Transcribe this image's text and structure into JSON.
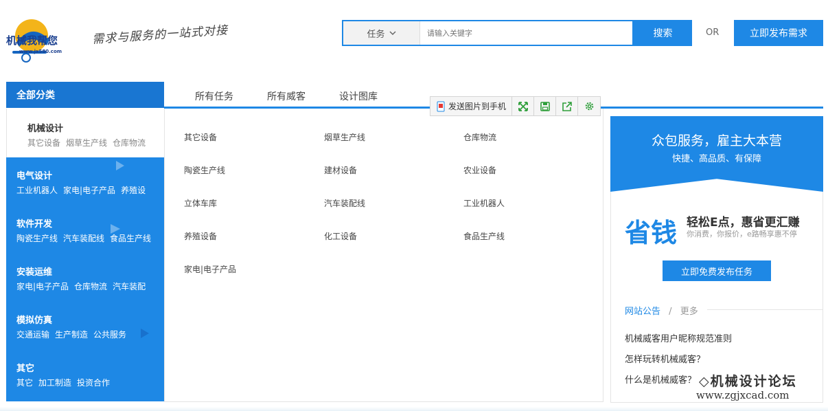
{
  "header": {
    "slogan": "需求与服务的一站式对接",
    "search": {
      "category": "任务",
      "placeholder": "请输入关键字",
      "button": "搜索"
    },
    "or_text": "OR",
    "publish_button": "立即发布需求"
  },
  "nav": {
    "all_categories": "全部分类",
    "tabs": [
      "所有任务",
      "所有威客",
      "设计图库"
    ]
  },
  "toolbar": {
    "send_label": "发送图片到手机",
    "icons": [
      "expand-icon",
      "save-icon",
      "share-icon",
      "settings-icon"
    ]
  },
  "menu": {
    "items": [
      {
        "title": "机械设计",
        "subs": [
          "其它设备",
          "烟草生产线",
          "仓库物流"
        ]
      },
      {
        "title": "电气设计",
        "subs": [
          "工业机器人",
          "家电|电子产品",
          "养殖设"
        ]
      },
      {
        "title": "软件开发",
        "subs": [
          "陶瓷生产线",
          "汽车装配线",
          "食品生产线"
        ]
      },
      {
        "title": "安装运维",
        "subs": [
          "家电|电子产品",
          "仓库物流",
          "汽车装配"
        ]
      },
      {
        "title": "模拟仿真",
        "subs": [
          "交通运输",
          "生产制造",
          "公共服务"
        ]
      },
      {
        "title": "其它",
        "subs": [
          "其它",
          "加工制造",
          "投资合作"
        ]
      }
    ]
  },
  "categories": {
    "rows": [
      [
        "其它设备",
        "烟草生产线",
        "仓库物流"
      ],
      [
        "陶瓷生产线",
        "建材设备",
        "农业设备"
      ],
      [
        "立体车库",
        "汽车装配线",
        "工业机器人"
      ],
      [
        "养殖设备",
        "化工设备",
        "食品生产线"
      ],
      [
        "家电|电子产品"
      ]
    ]
  },
  "sidebar": {
    "banner_title": "众包服务，雇主大本营",
    "banner_sub": "快捷、高品质、有保障",
    "save_big": "省钱",
    "save_text": "轻松E点，惠省更汇赚",
    "save_sub": "你消费，你报价，e路畅享惠不停",
    "free_button": "立即免费发布任务",
    "notice_title": "网站公告",
    "notice_sep": "/",
    "notice_more": "更多",
    "notices": [
      "机械威客用户昵称规范准则",
      "怎样玩转机械威客？",
      "什么是机械威客？"
    ]
  },
  "colors": {
    "accent": "#1e88e5",
    "accent_dark": "#1976d2"
  }
}
